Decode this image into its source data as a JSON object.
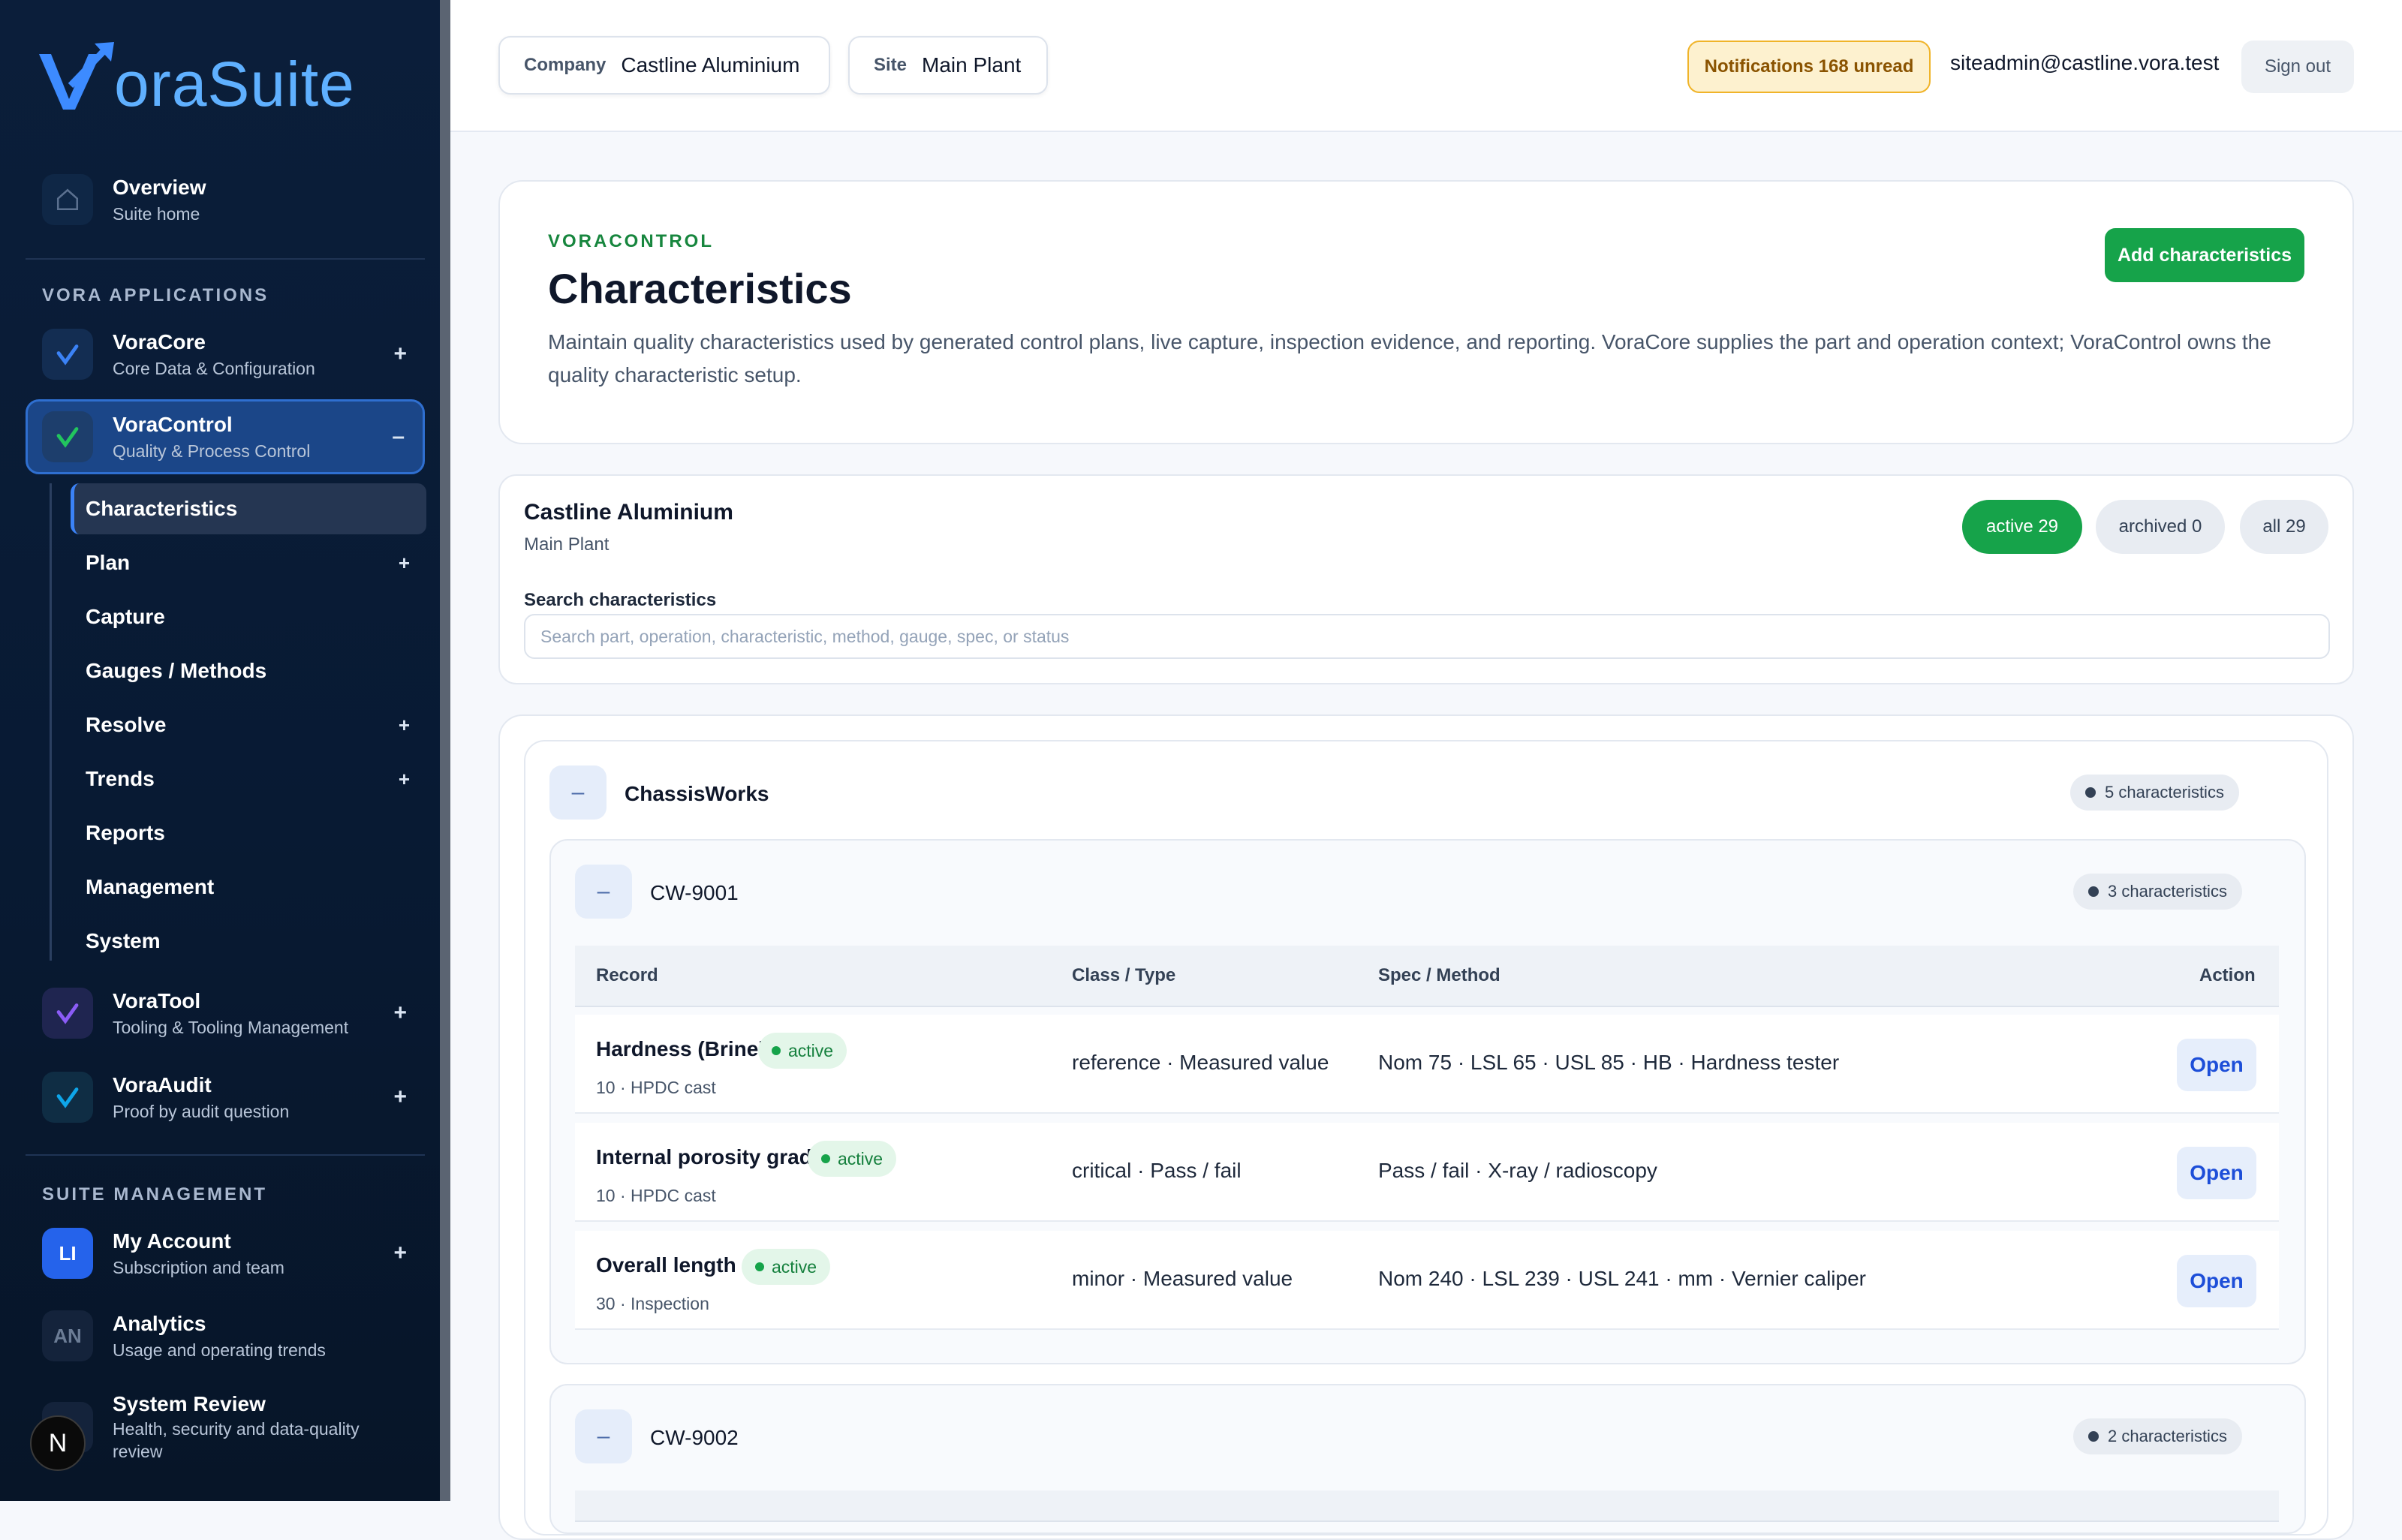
{
  "brand": {
    "name": "VoraSuite",
    "logo_text": "oraSuite",
    "accent": "#5fb0ff"
  },
  "sidebar": {
    "overview": {
      "title": "Overview",
      "subtitle": "Suite home"
    },
    "section_apps": "VORA APPLICATIONS",
    "apps": [
      {
        "title": "VoraCore",
        "subtitle": "Core Data & Configuration",
        "toggle": "+"
      },
      {
        "title": "VoraControl",
        "subtitle": "Quality & Process Control",
        "toggle": "–"
      },
      {
        "title": "VoraTool",
        "subtitle": "Tooling & Tooling Management",
        "toggle": "+"
      },
      {
        "title": "VoraAudit",
        "subtitle": "Proof by audit question",
        "toggle": "+"
      }
    ],
    "subnav": [
      {
        "label": "Characteristics",
        "toggle": ""
      },
      {
        "label": "Plan",
        "toggle": "+"
      },
      {
        "label": "Capture",
        "toggle": ""
      },
      {
        "label": "Gauges / Methods",
        "toggle": ""
      },
      {
        "label": "Resolve",
        "toggle": "+"
      },
      {
        "label": "Trends",
        "toggle": "+"
      },
      {
        "label": "Reports",
        "toggle": ""
      },
      {
        "label": "Management",
        "toggle": ""
      },
      {
        "label": "System",
        "toggle": ""
      }
    ],
    "section_suite": "SUITE MANAGEMENT",
    "suite": [
      {
        "initials": "LI",
        "title": "My Account",
        "subtitle": "Subscription and team",
        "toggle": "+"
      },
      {
        "initials": "AN",
        "title": "Analytics",
        "subtitle": "Usage and operating trends",
        "toggle": ""
      },
      {
        "initials": "",
        "title": "System Review",
        "subtitle": "Health, security and data-quality review",
        "toggle": ""
      }
    ],
    "dev_toggle": "N"
  },
  "header": {
    "company_label": "Company",
    "company_value": "Castline Aluminium",
    "site_label": "Site",
    "site_value": "Main Plant",
    "notifications": "Notifications 168 unread",
    "user_email": "siteadmin@castline.vora.test",
    "sign_out": "Sign out"
  },
  "page": {
    "eyebrow": "VORACONTROL",
    "title": "Characteristics",
    "description": "Maintain quality characteristics used by generated control plans, live capture, inspection evidence, and reporting. VoraCore supplies the part and operation context; VoraControl owns the quality characteristic setup.",
    "add_button": "Add characteristics"
  },
  "filters": {
    "company": "Castline Aluminium",
    "site": "Main Plant",
    "chips": [
      {
        "label": "active 29",
        "selected": true
      },
      {
        "label": "archived 0",
        "selected": false
      },
      {
        "label": "all 29",
        "selected": false
      }
    ],
    "search_label": "Search characteristics",
    "search_placeholder": "Search part, operation, characteristic, method, gauge, spec, or status"
  },
  "groups": [
    {
      "customer": "ChassisWorks",
      "collapse": "–",
      "count": "5 characteristics",
      "parts": [
        {
          "part": "CW-9001",
          "collapse": "–",
          "count": "3 characteristics",
          "columns": [
            "Record",
            "Class / Type",
            "Spec / Method",
            "Action"
          ],
          "rows": [
            {
              "name": "Hardness (Brinell)",
              "status": "active",
              "meta": "10 · HPDC cast",
              "class_type": "reference · Measured value",
              "spec": "Nom 75 · LSL 65 · USL 85 · HB · Hardness tester",
              "action": "Open"
            },
            {
              "name": "Internal porosity grade",
              "status": "active",
              "meta": "10 · HPDC cast",
              "class_type": "critical · Pass / fail",
              "spec": "Pass / fail · X-ray / radioscopy",
              "action": "Open"
            },
            {
              "name": "Overall length",
              "status": "active",
              "meta": "30 · Inspection",
              "class_type": "minor · Measured value",
              "spec": "Nom 240 · LSL 239 · USL 241 · mm · Vernier caliper",
              "action": "Open"
            }
          ]
        },
        {
          "part": "CW-9002",
          "collapse": "–",
          "count": "2 characteristics"
        }
      ]
    }
  ]
}
